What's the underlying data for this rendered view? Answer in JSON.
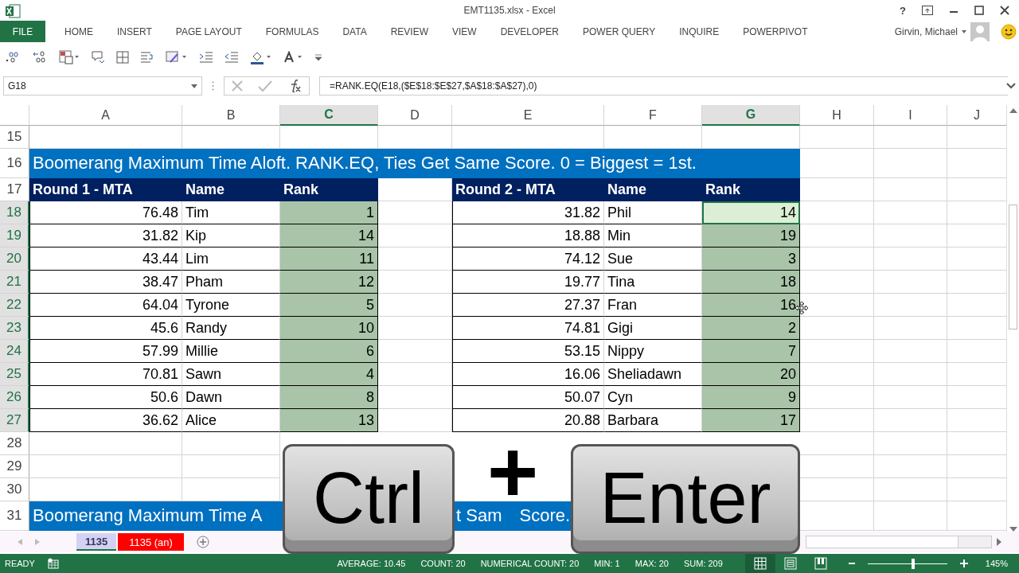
{
  "window": {
    "title": "EMT1135.xlsx - Excel",
    "help": "?"
  },
  "ribbon": {
    "tabs": [
      {
        "label": "FILE",
        "kind": "file"
      },
      {
        "label": "HOME",
        "kind": "tab"
      },
      {
        "label": "INSERT",
        "kind": "tab"
      },
      {
        "label": "PAGE LAYOUT",
        "kind": "tab"
      },
      {
        "label": "FORMULAS",
        "kind": "tab"
      },
      {
        "label": "DATA",
        "kind": "tab"
      },
      {
        "label": "REVIEW",
        "kind": "tab"
      },
      {
        "label": "VIEW",
        "kind": "tab"
      },
      {
        "label": "DEVELOPER",
        "kind": "tab"
      },
      {
        "label": "POWER QUERY",
        "kind": "tab"
      },
      {
        "label": "INQUIRE",
        "kind": "tab"
      },
      {
        "label": "POWERPIVOT",
        "kind": "tab"
      }
    ],
    "user": "Girvin, Michael"
  },
  "formula_bar": {
    "name_box": "G18",
    "formula": "=RANK.EQ(E18,($E$18:$E$27,$A$18:$A$27),0)"
  },
  "sheet": {
    "columns": [
      {
        "label": "A",
        "selected": false
      },
      {
        "label": "B",
        "selected": false
      },
      {
        "label": "C",
        "selected": true
      },
      {
        "label": "D",
        "selected": false
      },
      {
        "label": "E",
        "selected": false
      },
      {
        "label": "F",
        "selected": false
      },
      {
        "label": "G",
        "selected": true
      },
      {
        "label": "H",
        "selected": false
      },
      {
        "label": "I",
        "selected": false
      },
      {
        "label": "J",
        "selected": false
      }
    ],
    "rows": [
      {
        "number": "15",
        "kind": "blank",
        "selected": false
      },
      {
        "number": "16",
        "kind": "title",
        "selected": false,
        "text": "Boomerang Maximum Time Aloft. RANK.EQ, Ties Get Same Score. 0 = Biggest = 1st."
      },
      {
        "number": "17",
        "kind": "header",
        "selected": false,
        "cells": [
          "Round 1 - MTA",
          "Name",
          "Rank",
          "Round 2 - MTA",
          "Name",
          "Rank"
        ]
      },
      {
        "number": "18",
        "kind": "data",
        "selected": true,
        "left": {
          "value": "76.48",
          "name": "Tim",
          "rank": "1",
          "selected": false
        },
        "right": {
          "value": "31.82",
          "name": "Phil",
          "rank": "14",
          "selected": true
        }
      },
      {
        "number": "19",
        "kind": "data",
        "selected": true,
        "left": {
          "value": "31.82",
          "name": "Kip",
          "rank": "14",
          "selected": false
        },
        "right": {
          "value": "18.88",
          "name": "Min",
          "rank": "19",
          "selected": false
        }
      },
      {
        "number": "20",
        "kind": "data",
        "selected": true,
        "left": {
          "value": "43.44",
          "name": "Lim",
          "rank": "11",
          "selected": false
        },
        "right": {
          "value": "74.12",
          "name": "Sue",
          "rank": "3",
          "selected": false
        }
      },
      {
        "number": "21",
        "kind": "data",
        "selected": true,
        "left": {
          "value": "38.47",
          "name": "Pham",
          "rank": "12",
          "selected": false
        },
        "right": {
          "value": "19.77",
          "name": "Tina",
          "rank": "18",
          "selected": false
        }
      },
      {
        "number": "22",
        "kind": "data",
        "selected": true,
        "left": {
          "value": "64.04",
          "name": "Tyrone",
          "rank": "5",
          "selected": false
        },
        "right": {
          "value": "27.37",
          "name": "Fran",
          "rank": "16",
          "selected": false
        }
      },
      {
        "number": "23",
        "kind": "data",
        "selected": true,
        "left": {
          "value": "45.6",
          "name": "Randy",
          "rank": "10",
          "selected": false
        },
        "right": {
          "value": "74.81",
          "name": "Gigi",
          "rank": "2",
          "selected": false
        }
      },
      {
        "number": "24",
        "kind": "data",
        "selected": true,
        "left": {
          "value": "57.99",
          "name": "Millie",
          "rank": "6",
          "selected": false
        },
        "right": {
          "value": "53.15",
          "name": "Nippy",
          "rank": "7",
          "selected": false
        }
      },
      {
        "number": "25",
        "kind": "data",
        "selected": true,
        "left": {
          "value": "70.81",
          "name": "Sawn",
          "rank": "4",
          "selected": false
        },
        "right": {
          "value": "16.06",
          "name": "Sheliadawn",
          "rank": "20",
          "selected": false
        }
      },
      {
        "number": "26",
        "kind": "data",
        "selected": true,
        "left": {
          "value": "50.6",
          "name": "Dawn",
          "rank": "8",
          "selected": false
        },
        "right": {
          "value": "50.07",
          "name": "Cyn",
          "rank": "9",
          "selected": false
        }
      },
      {
        "number": "27",
        "kind": "data",
        "selected": true,
        "left": {
          "value": "36.62",
          "name": "Alice",
          "rank": "13",
          "selected": false
        },
        "right": {
          "value": "20.88",
          "name": "Barbara",
          "rank": "17",
          "selected": false
        }
      },
      {
        "number": "28",
        "kind": "blank",
        "selected": false
      },
      {
        "number": "29",
        "kind": "blank",
        "selected": false
      },
      {
        "number": "30",
        "kind": "blank",
        "selected": false
      },
      {
        "number": "31",
        "kind": "title_partial",
        "selected": false,
        "fragments": [
          "Boomerang Maximum Time A",
          "t Sam",
          "Score."
        ]
      }
    ]
  },
  "sheet_tabs": [
    {
      "label": "1135",
      "selected": true,
      "color": "#d4d2f2"
    },
    {
      "label": "1135 (an)",
      "selected": false,
      "color": "#ff0000"
    }
  ],
  "keystroke_overlay": [
    {
      "kind": "key",
      "label": "Ctrl"
    },
    {
      "kind": "plus",
      "label": "+"
    },
    {
      "kind": "key",
      "label": "Enter"
    }
  ],
  "status_bar": {
    "mode": "READY",
    "stats": [
      "AVERAGE: 10.45",
      "COUNT: 20",
      "NUMERICAL COUNT: 20",
      "MIN: 1",
      "MAX: 20",
      "SUM: 209"
    ],
    "views": [
      {
        "kind": "normal",
        "selected": true
      },
      {
        "kind": "page_layout",
        "selected": false
      },
      {
        "kind": "page_break",
        "selected": false
      }
    ],
    "zoom": {
      "level": 0.57,
      "reading": "145%"
    }
  }
}
